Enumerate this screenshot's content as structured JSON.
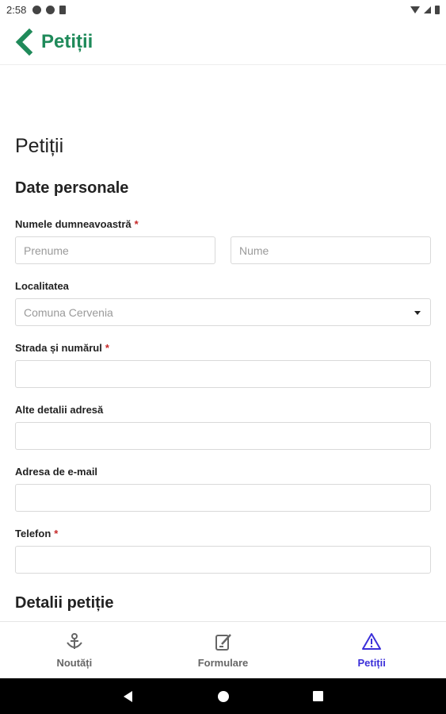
{
  "status_bar": {
    "time": "2:58",
    "left_icons": [
      "a-circle-icon",
      "p-circle-icon",
      "sd-card-icon"
    ],
    "right_icons": [
      "wifi-icon",
      "signal-icon",
      "battery-icon"
    ]
  },
  "app_bar": {
    "title": "Petiții",
    "back_icon": "chevron-left-icon",
    "accent_color": "#1f8a5a"
  },
  "form": {
    "page_heading": "Petiții",
    "section_personal": "Date personale",
    "name_label": "Numele dumneavoastră",
    "first_name_placeholder": "Prenume",
    "last_name_placeholder": "Nume",
    "locality_label": "Localitatea",
    "locality_value": "Comuna Cervenia",
    "street_label": "Strada și numărul",
    "address_details_label": "Alte detalii adresă",
    "email_label": "Adresa de e-mail",
    "phone_label": "Telefon",
    "required_marker": "*",
    "section_petition": "Detalii petiție"
  },
  "bottom_nav": {
    "items": [
      {
        "label": "Noutăți",
        "icon": "news-icon",
        "active": false
      },
      {
        "label": "Formulare",
        "icon": "form-edit-icon",
        "active": false
      },
      {
        "label": "Petiții",
        "icon": "warning-triangle-icon",
        "active": true
      }
    ],
    "active_color": "#3b2fd9"
  },
  "android_nav": {
    "buttons": [
      "back-triangle-icon",
      "home-circle-icon",
      "recents-square-icon"
    ]
  }
}
